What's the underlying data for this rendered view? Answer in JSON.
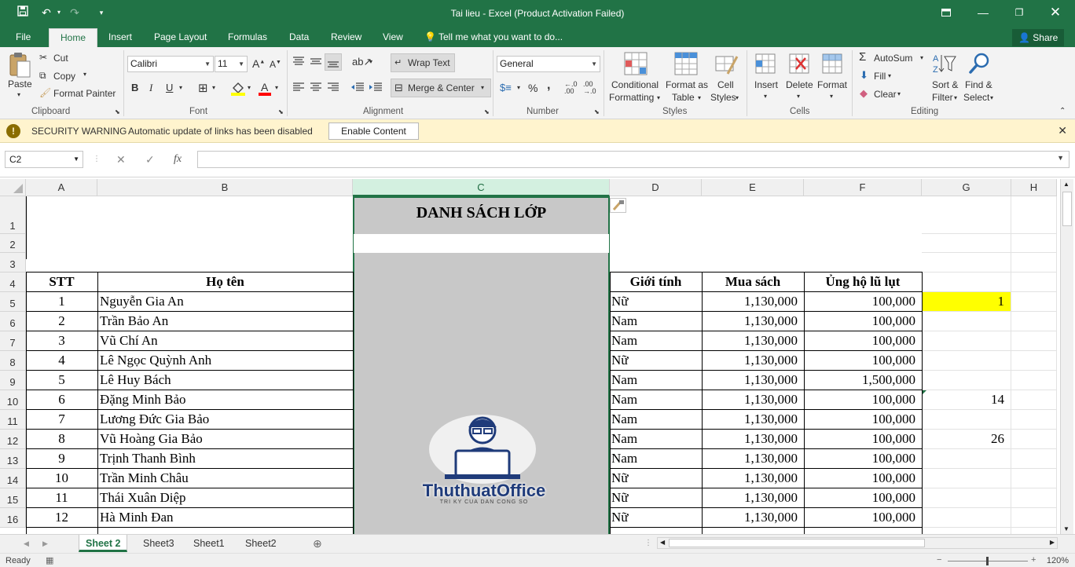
{
  "window": {
    "title": "Tai lieu - Excel (Product Activation Failed)",
    "share": "Share"
  },
  "tabs": [
    "File",
    "Home",
    "Insert",
    "Page Layout",
    "Formulas",
    "Data",
    "Review",
    "View"
  ],
  "tell_me": "Tell me what you want to do...",
  "ribbon": {
    "clipboard": {
      "paste": "Paste",
      "cut": "Cut",
      "copy": "Copy",
      "format_painter": "Format Painter",
      "label": "Clipboard"
    },
    "font": {
      "name": "Calibri",
      "size": "11",
      "label": "Font",
      "bold": "B",
      "italic": "I",
      "underline": "U"
    },
    "alignment": {
      "wrap": "Wrap Text",
      "merge": "Merge & Center",
      "label": "Alignment"
    },
    "number": {
      "format": "General",
      "label": "Number",
      "percent": "%",
      "comma": ","
    },
    "styles": {
      "conditional": "Conditional",
      "conditional2": "Formatting",
      "format_as": "Format as",
      "format_as2": "Table",
      "cell": "Cell",
      "cell2": "Styles",
      "label": "Styles"
    },
    "cells": {
      "insert": "Insert",
      "delete": "Delete",
      "format": "Format",
      "label": "Cells"
    },
    "editing": {
      "autosum": "AutoSum",
      "fill": "Fill",
      "clear": "Clear",
      "sort": "Sort &",
      "sort2": "Filter",
      "find": "Find &",
      "find2": "Select",
      "label": "Editing"
    }
  },
  "security": {
    "title": "SECURITY WARNING",
    "message": "Automatic update of links has been disabled",
    "button": "Enable Content"
  },
  "formula_bar": {
    "name_box": "C2",
    "fx": "fx",
    "value": ""
  },
  "columns": [
    "A",
    "B",
    "C",
    "D",
    "E",
    "F",
    "G",
    "H"
  ],
  "rows": [
    "1",
    "2",
    "3",
    "4",
    "5",
    "6",
    "7",
    "8",
    "9",
    "10",
    "11",
    "12",
    "13",
    "14",
    "15",
    "16"
  ],
  "sheet": {
    "title": "DANH SÁCH LỚP",
    "headers": {
      "stt": "STT",
      "name": "Họ tên",
      "gender": "Giới tính",
      "books": "Mua sách",
      "flood": "Ủng hộ lũ lụt"
    },
    "records": [
      {
        "stt": "1",
        "name": "Nguyễn Gia An",
        "gender": "Nữ",
        "books": "1,130,000",
        "flood": "100,000"
      },
      {
        "stt": "2",
        "name": "Trần Bảo An",
        "gender": "Nam",
        "books": "1,130,000",
        "flood": "100,000"
      },
      {
        "stt": "3",
        "name": "Vũ Chí An",
        "gender": "Nam",
        "books": "1,130,000",
        "flood": "100,000"
      },
      {
        "stt": "4",
        "name": "Lê Ngọc Quỳnh Anh",
        "gender": "Nữ",
        "books": "1,130,000",
        "flood": "100,000"
      },
      {
        "stt": "5",
        "name": "Lê Huy Bách",
        "gender": "Nam",
        "books": "1,130,000",
        "flood": "1,500,000"
      },
      {
        "stt": "6",
        "name": "Đặng Minh Bảo",
        "gender": "Nam",
        "books": "1,130,000",
        "flood": "100,000"
      },
      {
        "stt": "7",
        "name": "Lương Đức Gia Bảo",
        "gender": "Nam",
        "books": "1,130,000",
        "flood": "100,000"
      },
      {
        "stt": "8",
        "name": "Vũ Hoàng Gia Bảo",
        "gender": "Nam",
        "books": "1,130,000",
        "flood": "100,000"
      },
      {
        "stt": "9",
        "name": "Trịnh Thanh Bình",
        "gender": "Nam",
        "books": "1,130,000",
        "flood": "100,000"
      },
      {
        "stt": "10",
        "name": "Trần Minh Châu",
        "gender": "Nữ",
        "books": "1,130,000",
        "flood": "100,000"
      },
      {
        "stt": "11",
        "name": "Thái Xuân Diệp",
        "gender": "Nữ",
        "books": "1,130,000",
        "flood": "100,000"
      },
      {
        "stt": "12",
        "name": "Hà Minh Đan",
        "gender": "Nữ",
        "books": "1,130,000",
        "flood": "100,000"
      }
    ],
    "g_values": {
      "g5": "1",
      "g10": "14",
      "g12": "26"
    },
    "highlight_color": "#ffff00"
  },
  "watermark": {
    "brand": "ThuthuatOffice",
    "tagline": "TRI KY CUA DAN CONG SO"
  },
  "sheet_tabs": [
    "Sheet 2",
    "Sheet3",
    "Sheet1",
    "Sheet2"
  ],
  "status": {
    "ready": "Ready",
    "zoom": "120%"
  },
  "colors": {
    "excel_green": "#217346",
    "warning_bg": "#fff4ce",
    "merged_fill": "#c8c8c8"
  }
}
